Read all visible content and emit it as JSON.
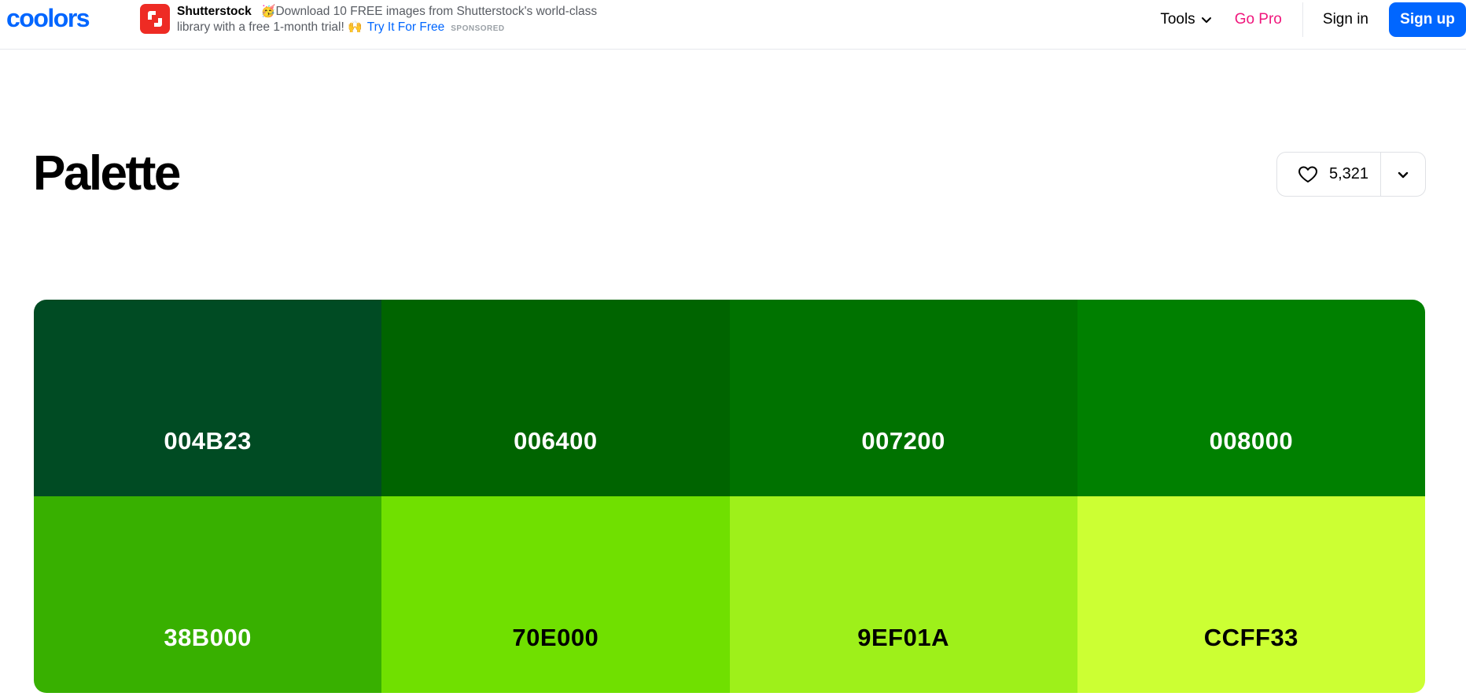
{
  "navbar": {
    "logo_text": "coolors",
    "ad": {
      "icon": "shutterstock-logo-icon",
      "brand": "Shutterstock",
      "emoji_start": "🥳",
      "text": "Download 10 FREE images from Shutterstock's world-class library with a free 1-month trial!",
      "emoji_end": "🙌",
      "cta": "Try It For Free",
      "sponsored": "SPONSORED"
    },
    "tools_label": "Tools",
    "gopro_label": "Go Pro",
    "signin_label": "Sign in",
    "signup_label": "Sign up"
  },
  "page": {
    "title": "Palette",
    "like_count": "5,321"
  },
  "palette": {
    "swatches": [
      {
        "code": "004B23",
        "color": "#004b23",
        "text_color": "#ffffff"
      },
      {
        "code": "006400",
        "color": "#006400",
        "text_color": "#ffffff"
      },
      {
        "code": "007200",
        "color": "#007200",
        "text_color": "#ffffff"
      },
      {
        "code": "008000",
        "color": "#008000",
        "text_color": "#ffffff"
      },
      {
        "code": "38B000",
        "color": "#38b000",
        "text_color": "#ffffff"
      },
      {
        "code": "70E000",
        "color": "#70e000",
        "text_color": "#000000"
      },
      {
        "code": "9EF01A",
        "color": "#9ef01a",
        "text_color": "#000000"
      },
      {
        "code": "CCFF33",
        "color": "#ccff33",
        "text_color": "#000000"
      }
    ]
  },
  "colors": {
    "brand_blue": "#0066ff",
    "go_pro_pink": "#f0167c"
  }
}
